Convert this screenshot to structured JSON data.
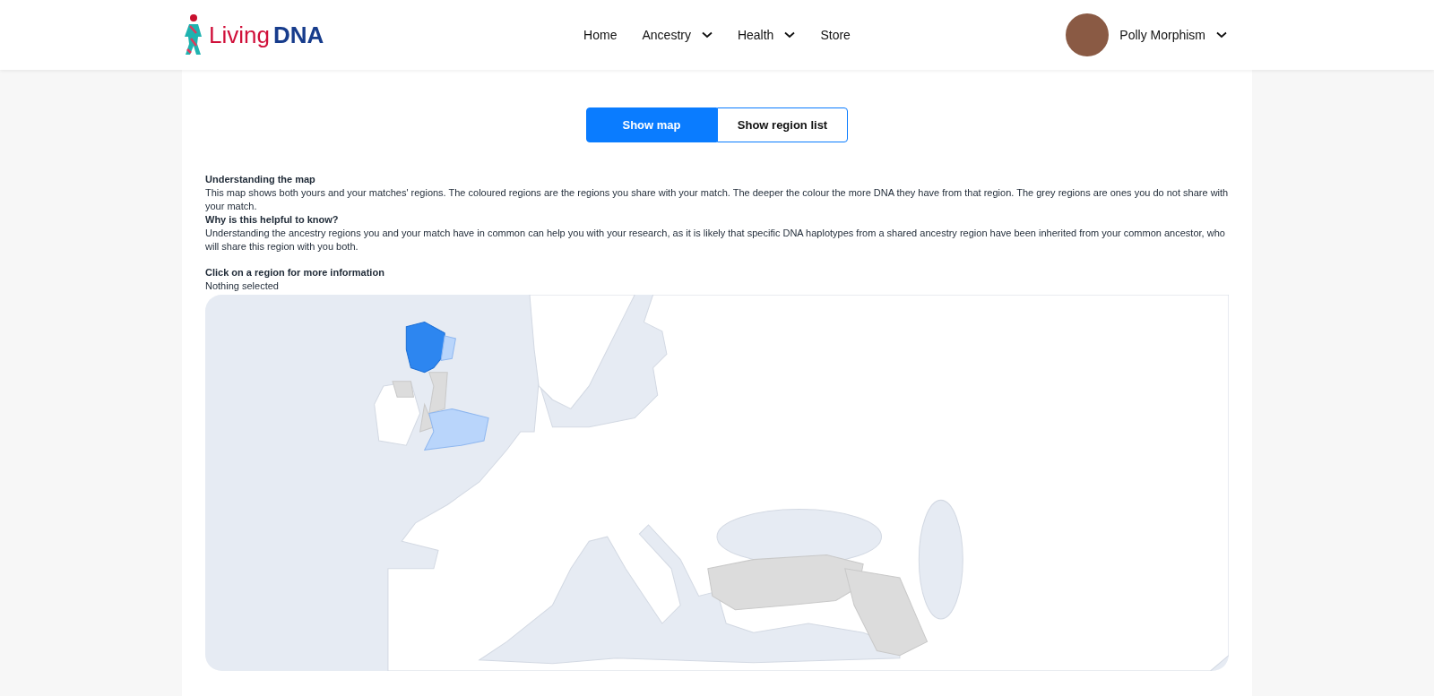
{
  "header": {
    "logo": {
      "first": "Living",
      "second": "DNA"
    },
    "nav": [
      {
        "label": "Home",
        "kind": "link"
      },
      {
        "label": "Ancestry",
        "kind": "dropdown"
      },
      {
        "label": "Health",
        "kind": "dropdown"
      },
      {
        "label": "Store",
        "kind": "link"
      }
    ],
    "user": {
      "name": "Polly Morphism"
    }
  },
  "view_toggle": [
    {
      "label": "Show map",
      "selected": true
    },
    {
      "label": "Show region list",
      "selected": false
    }
  ],
  "info": [
    {
      "heading": "Understanding the map",
      "text": "This map shows both yours and your matches' regions. The coloured regions are the regions you share with your match. The deeper the colour the more DNA they have from that region. The grey regions are ones you do not share with your match."
    },
    {
      "heading": "Why is this helpful to know?",
      "text": "Understanding the ancestry regions you and your match have in common can help you with your research, as it is likely that specific DNA haplotypes from a shared ancestry region have been inherited from your common ancestor, who will share this region with you both."
    }
  ],
  "selection": {
    "heading": "Click on a region for more information",
    "status": "Nothing selected"
  }
}
